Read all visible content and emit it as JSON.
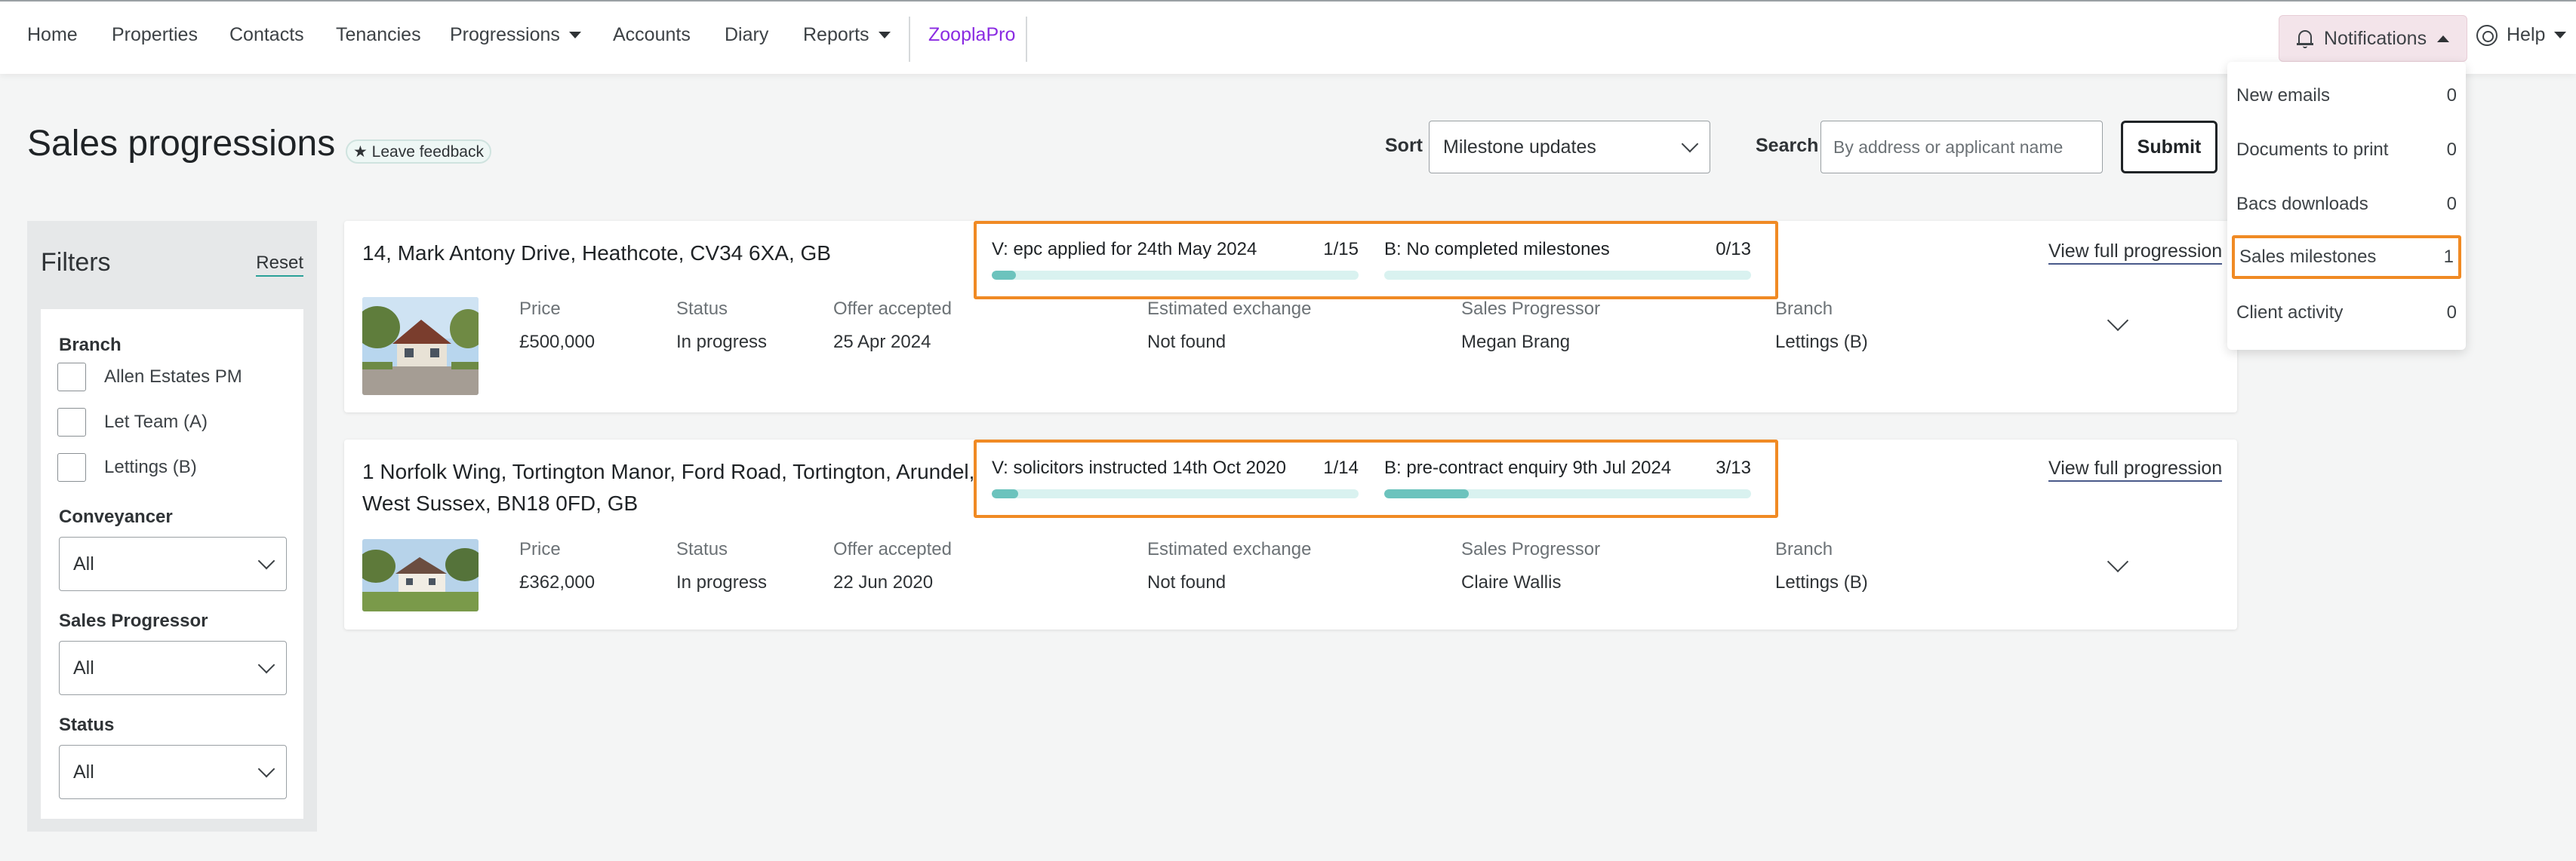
{
  "nav": {
    "items": [
      "Home",
      "Properties",
      "Contacts",
      "Tenancies",
      "Progressions",
      "Accounts",
      "Diary",
      "Reports",
      "ZooplaPro"
    ],
    "notifications_label": "Notifications",
    "help_label": "Help"
  },
  "notifications_menu": [
    {
      "label": "New emails",
      "count": "0"
    },
    {
      "label": "Documents to print",
      "count": "0"
    },
    {
      "label": "Bacs downloads",
      "count": "0"
    },
    {
      "label": "Sales milestones",
      "count": "1",
      "highlighted": true
    },
    {
      "label": "Client activity",
      "count": "0"
    }
  ],
  "header": {
    "title": "Sales progressions",
    "feedback": "★ Leave feedback",
    "sort_label": "Sort",
    "sort_value": "Milestone updates",
    "search_label": "Search",
    "search_placeholder": "By address or applicant name",
    "submit": "Submit"
  },
  "filters": {
    "title": "Filters",
    "reset": "Reset",
    "branch_label": "Branch",
    "branches": [
      "Allen Estates PM",
      "Let Team (A)",
      "Lettings (B)"
    ],
    "conveyancer_label": "Conveyancer",
    "conveyancer_value": "All",
    "progressor_label": "Sales Progressor",
    "progressor_value": "All",
    "status_label": "Status",
    "status_value": "All"
  },
  "columns": {
    "price": "Price",
    "status": "Status",
    "offer": "Offer accepted",
    "exchange": "Estimated exchange",
    "progressor": "Sales Progressor",
    "branch": "Branch"
  },
  "progressions": [
    {
      "address": "14, Mark Antony Drive, Heathcote, CV34 6XA, GB",
      "vendor_milestone": "V: epc applied for 24th May 2024",
      "vendor_count": "1/15",
      "vendor_progress": 0.0667,
      "buyer_milestone": "B: No completed milestones",
      "buyer_count": "0/13",
      "buyer_progress": 0,
      "view_link": "View full progression",
      "price": "£500,000",
      "status": "In progress",
      "offer_accepted": "25 Apr 2024",
      "estimated_exchange": "Not found",
      "sales_progressor": "Megan Brang",
      "branch": "Lettings (B)"
    },
    {
      "address": "1 Norfolk Wing, Tortington Manor, Ford Road, Tortington, Arundel, West Sussex, BN18 0FD, GB",
      "vendor_milestone": "V: solicitors instructed 14th Oct 2020",
      "vendor_count": "1/14",
      "vendor_progress": 0.0714,
      "buyer_milestone": "B: pre-contract enquiry 9th Jul 2024",
      "buyer_count": "3/13",
      "buyer_progress": 0.2308,
      "view_link": "View full progression",
      "price": "£362,000",
      "status": "In progress",
      "offer_accepted": "22 Jun 2020",
      "estimated_exchange": "Not found",
      "sales_progressor": "Claire Wallis",
      "branch": "Lettings (B)"
    }
  ],
  "colors": {
    "accent_teal": "#6cc3bd",
    "highlight_orange": "#f08a24",
    "zoopla_purple": "#8a2be2"
  }
}
